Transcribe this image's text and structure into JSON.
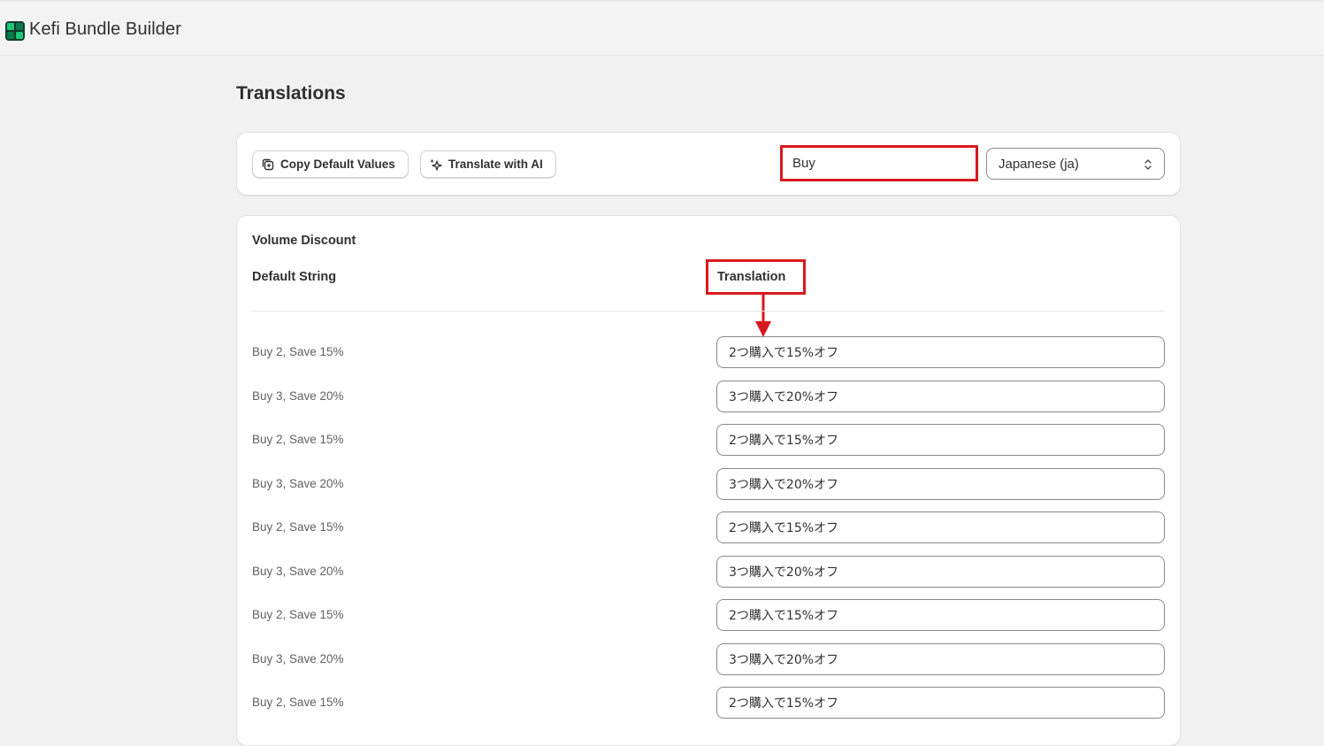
{
  "app": {
    "title": "Kefi Bundle Builder",
    "logo_icon": "kefi-logo-icon",
    "brand_colors": [
      "#0b7a4b",
      "#1fc77a",
      "#0d3b2a"
    ]
  },
  "page": {
    "title": "Translations"
  },
  "toolbar": {
    "copy_default_label": "Copy Default Values",
    "copy_default_icon": "copy-icon",
    "translate_ai_label": "Translate with AI",
    "translate_ai_icon": "sparkle-icon",
    "search_value": "Buy",
    "language_selected": "Japanese (ja)",
    "language_icon": "select-chevron-icon",
    "highlight_color": "#d9191f"
  },
  "table": {
    "section_title": "Volume Discount",
    "header_default": "Default String",
    "header_translation": "Translation",
    "rows": [
      {
        "default": "Buy 2, Save 15%",
        "translation": "2つ購入で15%オフ"
      },
      {
        "default": "Buy 3, Save 20%",
        "translation": "3つ購入で20%オフ"
      },
      {
        "default": "Buy 2, Save 15%",
        "translation": "2つ購入で15%オフ"
      },
      {
        "default": "Buy 3, Save 20%",
        "translation": "3つ購入で20%オフ"
      },
      {
        "default": "Buy 2, Save 15%",
        "translation": "2つ購入で15%オフ"
      },
      {
        "default": "Buy 3, Save 20%",
        "translation": "3つ購入で20%オフ"
      },
      {
        "default": "Buy 2, Save 15%",
        "translation": "2つ購入で15%オフ"
      },
      {
        "default": "Buy 3, Save 20%",
        "translation": "3つ購入で20%オフ"
      },
      {
        "default": "Buy 2, Save 15%",
        "translation": "2つ購入で15%オフ"
      }
    ]
  }
}
